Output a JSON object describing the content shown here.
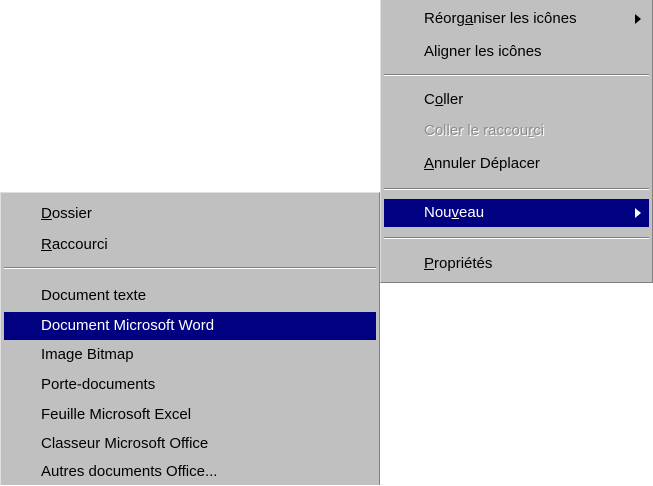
{
  "context_menu": {
    "items": [
      {
        "before": "Réorg",
        "mn": "a",
        "after": "niser les icônes"
      },
      {
        "before": "Aligner les icônes",
        "mn": "",
        "after": ""
      },
      {
        "before": "C",
        "mn": "o",
        "after": "ller"
      },
      {
        "before": "Coller le raccou",
        "mn": "r",
        "after": "ci"
      },
      {
        "before": "",
        "mn": "A",
        "after": "nnuler Déplacer"
      },
      {
        "before": "Nou",
        "mn": "v",
        "after": "eau"
      },
      {
        "before": "",
        "mn": "P",
        "after": "ropriétés"
      }
    ]
  },
  "submenu": {
    "items": [
      {
        "before": "",
        "mn": "D",
        "after": "ossier"
      },
      {
        "before": "",
        "mn": "R",
        "after": "accourci"
      },
      {
        "before": "Document texte",
        "mn": "",
        "after": ""
      },
      {
        "before": "Document Microsoft Word",
        "mn": "",
        "after": ""
      },
      {
        "before": "Image Bitmap",
        "mn": "",
        "after": ""
      },
      {
        "before": "Porte-documents",
        "mn": "",
        "after": ""
      },
      {
        "before": "Feuille Microsoft Excel",
        "mn": "",
        "after": ""
      },
      {
        "before": "Classeur Microsoft Office",
        "mn": "",
        "after": ""
      },
      {
        "before": "Autres documents Office...",
        "mn": "",
        "after": ""
      }
    ]
  },
  "colors": {
    "menu_bg": "#c0c0c0",
    "highlight": "#000080",
    "disabled": "#8c8c8c"
  }
}
